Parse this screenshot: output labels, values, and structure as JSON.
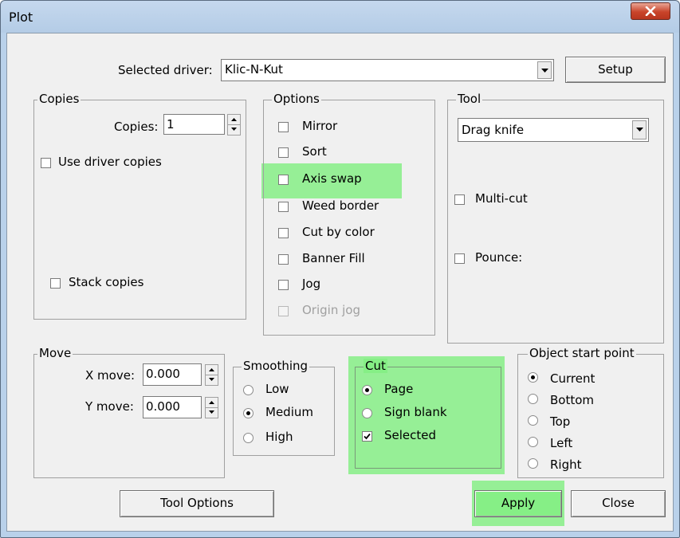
{
  "window": {
    "title": "Plot"
  },
  "header": {
    "driver_label": "Selected driver:",
    "driver_value": "Klic-N-Kut",
    "setup_label": "Setup"
  },
  "copies": {
    "group_label": "Copies",
    "copies_label": "Copies:",
    "copies_value": "1",
    "use_driver_copies_label": "Use driver copies",
    "stack_copies_label": "Stack copies"
  },
  "options": {
    "group_label": "Options",
    "items": [
      {
        "label": "Mirror",
        "checked": false
      },
      {
        "label": "Sort",
        "checked": false
      },
      {
        "label": "Axis swap",
        "checked": false
      },
      {
        "label": "Weed border",
        "checked": false
      },
      {
        "label": "Cut by color",
        "checked": false
      },
      {
        "label": "Banner Fill",
        "checked": false
      },
      {
        "label": "Jog",
        "checked": false
      },
      {
        "label": "Origin jog",
        "checked": false,
        "disabled": true
      }
    ]
  },
  "tool": {
    "group_label": "Tool",
    "tool_value": "Drag knife",
    "multicut_label": "Multi-cut",
    "pounce_label": "Pounce:"
  },
  "move": {
    "group_label": "Move",
    "x_label": "X move:",
    "x_value": "0.000",
    "y_label": "Y move:",
    "y_value": "0.000"
  },
  "smoothing": {
    "group_label": "Smoothing",
    "items": [
      {
        "label": "Low",
        "selected": false
      },
      {
        "label": "Medium",
        "selected": true
      },
      {
        "label": "High",
        "selected": false
      }
    ]
  },
  "cut": {
    "group_label": "Cut",
    "page_label": "Page",
    "signblank_label": "Sign blank",
    "selected_label": "Selected",
    "selected_checked": true
  },
  "start_point": {
    "group_label": "Object start point",
    "items": [
      {
        "label": "Current",
        "selected": true
      },
      {
        "label": "Bottom",
        "selected": false
      },
      {
        "label": "Top",
        "selected": false
      },
      {
        "label": "Left",
        "selected": false
      },
      {
        "label": "Right",
        "selected": false
      }
    ]
  },
  "footer": {
    "tool_options_label": "Tool Options",
    "apply_label": "Apply",
    "close_label": "Close"
  },
  "highlight_color": "#86ef86"
}
